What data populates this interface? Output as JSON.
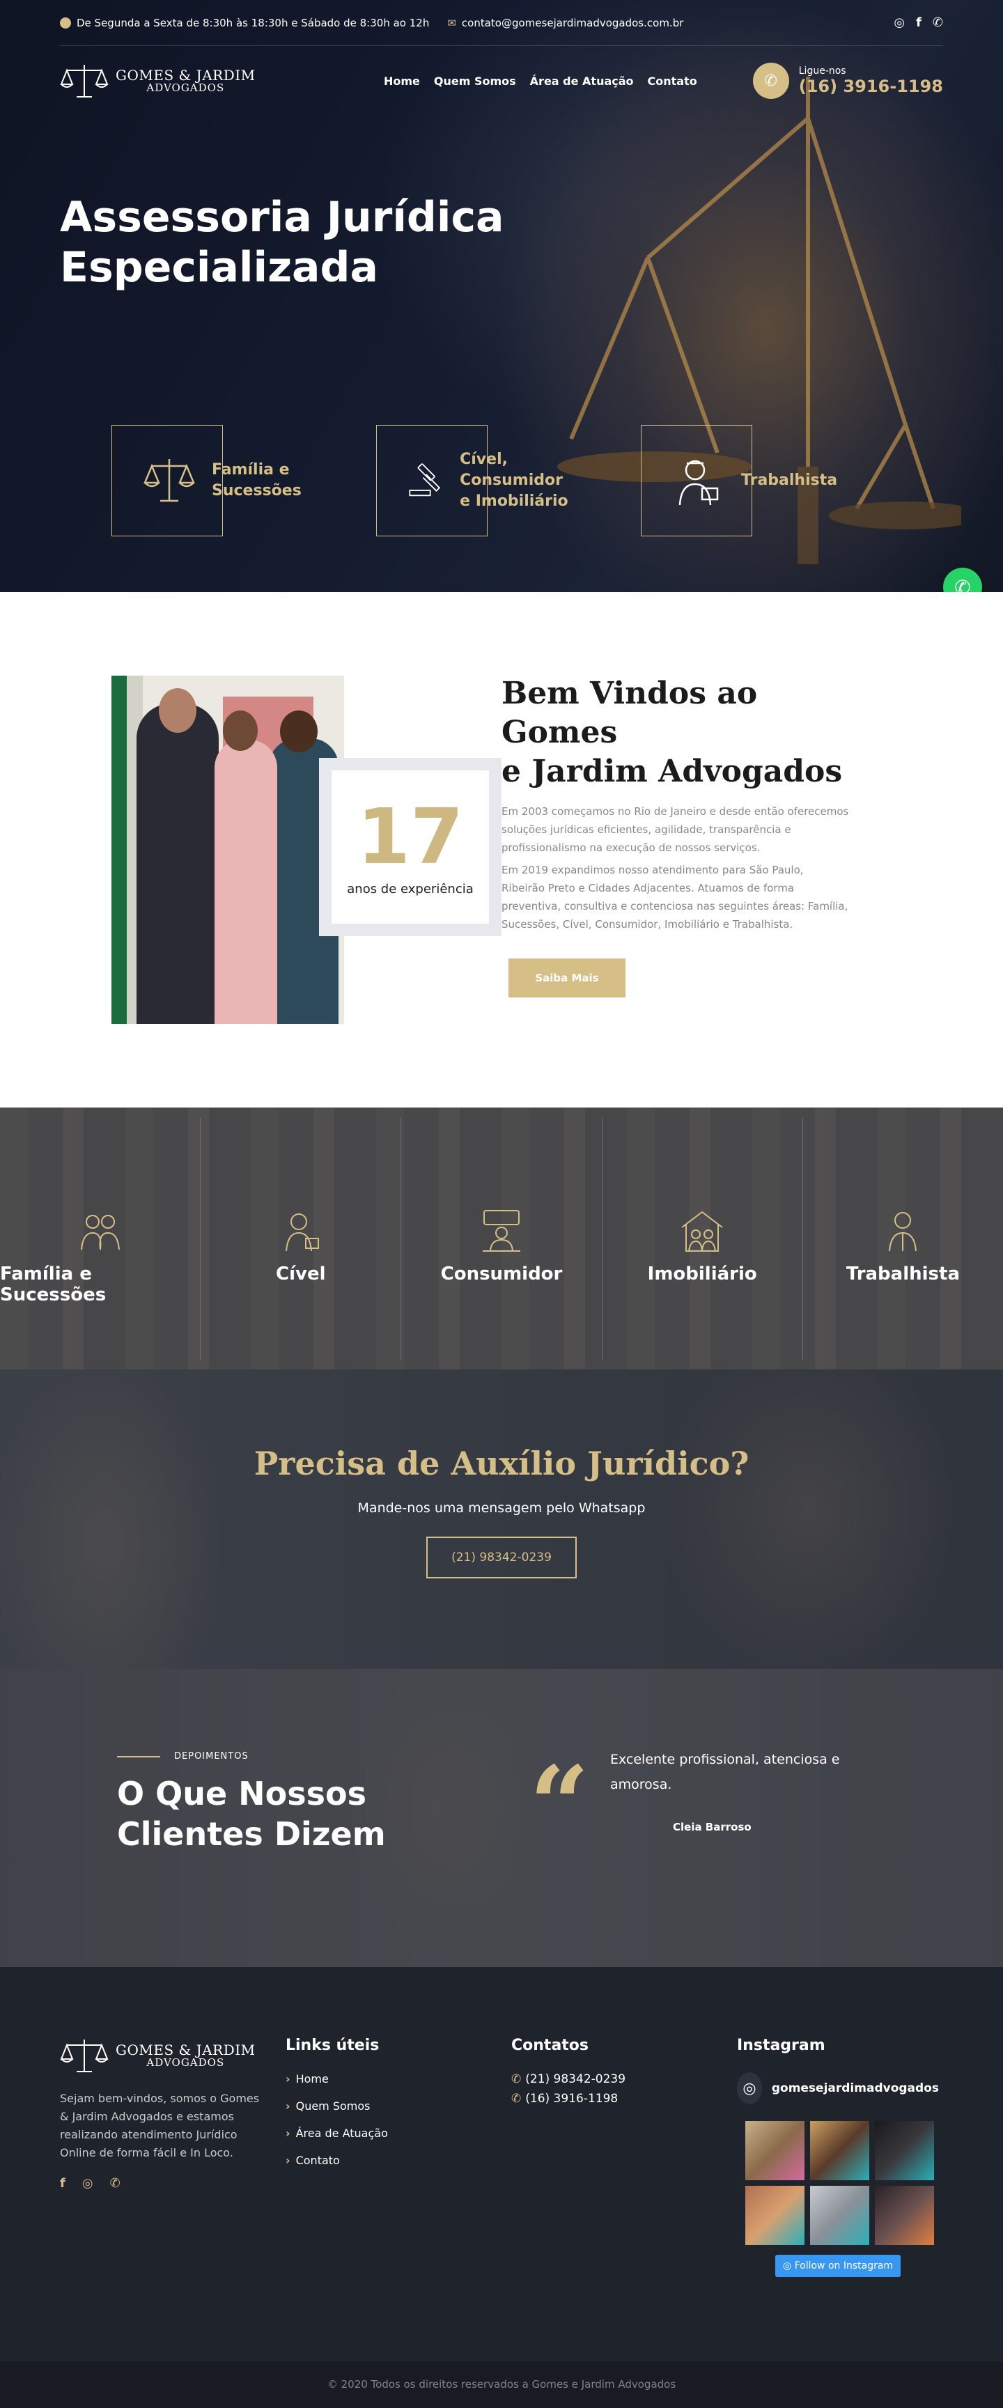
{
  "topbar": {
    "hours": "De Segunda a Sexta de 8:30h às 18:30h e Sábado de 8:30h ao 12h",
    "email": "contato@gomesejardimadvogados.com.br"
  },
  "brand": {
    "name": "GOMES & JARDIM",
    "sub": "ADVOGADOS"
  },
  "nav": {
    "items": [
      "Home",
      "Quem Somos",
      "Área de Atuação",
      "Contato"
    ]
  },
  "call": {
    "label": "Ligue-nos",
    "phone": "(16) 3916-1198"
  },
  "hero": {
    "title_line1": "Assessoria Jurídica",
    "title_line2": "Especializada",
    "areas": [
      {
        "line1": "Família e",
        "line2": "Sucessões"
      },
      {
        "line1": "Cível, Consumidor",
        "line2": "e Imobiliário"
      },
      {
        "line1": "Trabalhista",
        "line2": ""
      }
    ]
  },
  "welcome": {
    "title_line1": "Bem Vindos ao Gomes",
    "title_line2": "e Jardim Advogados",
    "years": "17",
    "years_label": "anos de experiência",
    "p1": "Em 2003 começamos no Rio de Janeiro e desde então oferecemos soluções jurídicas eficientes, agilidade, transparência e profissionalismo na execução de nossos serviços.",
    "p2": "Em 2019 expandimos nosso atendimento para São Paulo, Ribeirão Preto e Cidades Adjacentes. Atuamos de forma preventiva, consultiva e contenciosa nas seguintes áreas: Família, Sucessões, Cível, Consumidor, Imobiliário e Trabalhista.",
    "button": "Saiba Mais"
  },
  "practice": [
    "Família e Sucessões",
    "Cível",
    "Consumidor",
    "Imobiliário",
    "Trabalhista"
  ],
  "cta": {
    "title": "Precisa de Auxílio Jurídico?",
    "text": "Mande-nos uma mensagem pelo Whatsapp",
    "button": "(21) 98342-0239"
  },
  "testimonials": {
    "kicker": "DEPOIMENTOS",
    "title_line1": "O Que Nossos",
    "title_line2": "Clientes Dizem",
    "quote": "Excelente profissional, atenciosa e amorosa.",
    "author": "Cleia Barroso"
  },
  "footer": {
    "about": "Sejam bem-vindos, somos o Gomes & Jardim Advogados e estamos realizando atendimento Jurídico Online de forma fácil e In Loco.",
    "links_title": "Links úteis",
    "links": [
      "Home",
      "Quem Somos",
      "Área de Atuação",
      "Contato"
    ],
    "contacts_title": "Contatos",
    "phones": [
      "(21) 98342-0239",
      "(16) 3916-1198"
    ],
    "instagram_title": "Instagram",
    "instagram_account": "gomesejardimadvogados",
    "follow": "Follow on Instagram",
    "copyright": "© 2020 Todos os direitos reservados a Gomes e Jardim Advogados"
  },
  "colors": {
    "accent": "#d6bf87",
    "dark": "#1f232b",
    "whatsapp": "#25d366"
  },
  "icons": [
    "clock-icon",
    "email-icon",
    "instagram-icon",
    "facebook-icon",
    "whatsapp-icon",
    "phone-icon",
    "scale-icon",
    "gavel-icon",
    "worker-icon"
  ]
}
